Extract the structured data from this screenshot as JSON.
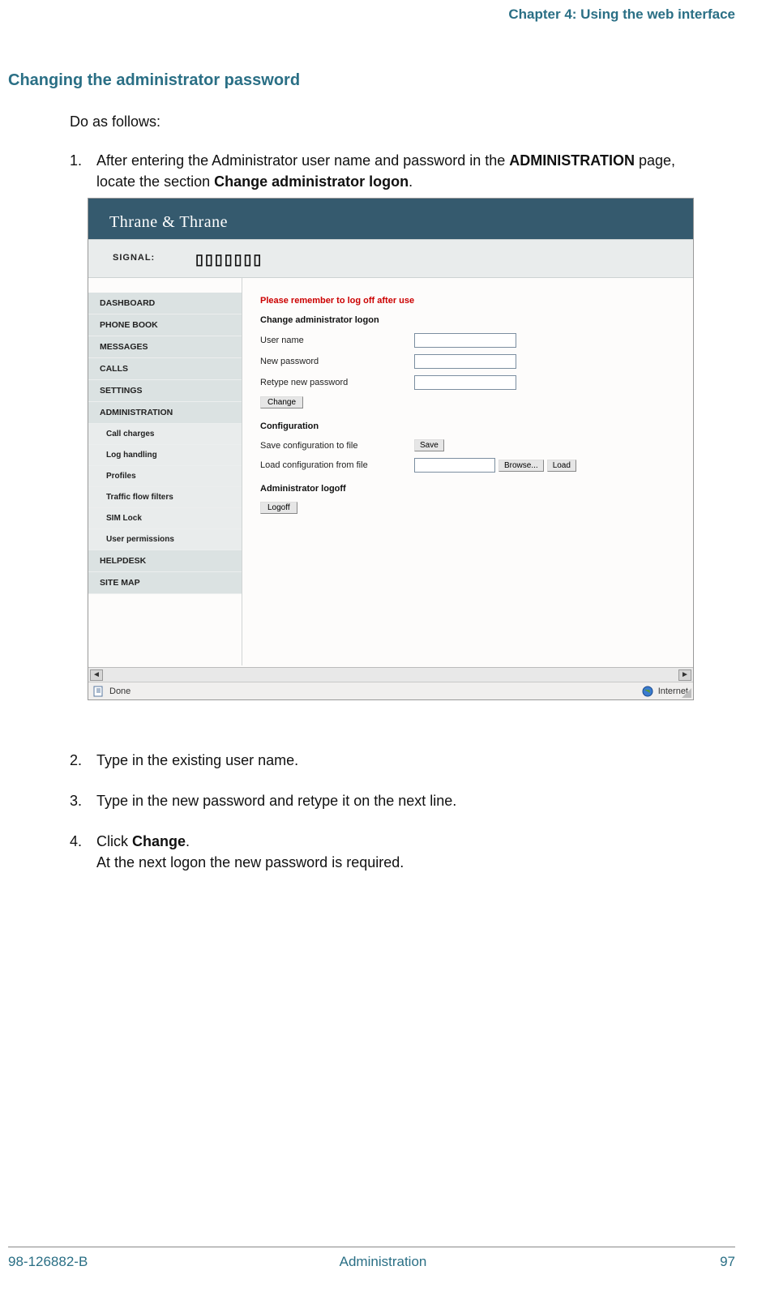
{
  "header": {
    "chapter": "Chapter 4: Using the web interface"
  },
  "section": {
    "title": "Changing the administrator password"
  },
  "intro": "Do as follows:",
  "steps": {
    "s1_num": "1.",
    "s1_a": "After entering the Administrator user name and password in the ",
    "s1_b": "ADMINISTRATION",
    "s1_c": " page, locate the section ",
    "s1_d": "Change administrator logon",
    "s1_e": ".",
    "s2_num": "2.",
    "s2": "Type in the existing user name.",
    "s3_num": "3.",
    "s3": "Type in the new password and retype it on the next line.",
    "s4_num": "4.",
    "s4_a": "Click ",
    "s4_b": "Change",
    "s4_c": ".",
    "s4_d": "At the next logon the new password is required."
  },
  "screenshot": {
    "brand": "Thrane & Thrane",
    "signal_label": "SIGNAL:",
    "signal_bars": "▯▯▯▯▯▯▯",
    "nav": {
      "dashboard": "DASHBOARD",
      "phonebook": "PHONE BOOK",
      "messages": "MESSAGES",
      "calls": "CALLS",
      "settings": "SETTINGS",
      "administration": "ADMINISTRATION",
      "call_charges": "Call charges",
      "log_handling": "Log handling",
      "profiles": "Profiles",
      "traffic_flow": "Traffic flow filters",
      "sim_lock": "SIM Lock",
      "user_permissions": "User permissions",
      "helpdesk": "HELPDESK",
      "sitemap": "SITE MAP"
    },
    "content": {
      "warning": "Please remember to log off after use",
      "group1": "Change administrator logon",
      "username_label": "User name",
      "newpass_label": "New password",
      "retype_label": "Retype new password",
      "change_btn": "Change",
      "group2": "Configuration",
      "save_label": "Save configuration to file",
      "save_btn": "Save",
      "load_label": "Load configuration from file",
      "browse_btn": "Browse...",
      "load_btn": "Load",
      "group3": "Administrator logoff",
      "logoff_btn": "Logoff"
    },
    "status": {
      "done": "Done",
      "zone": "Internet",
      "arrow_left": "◄",
      "arrow_right": "►"
    }
  },
  "footer": {
    "left": "98-126882-B",
    "center": "Administration",
    "right": "97"
  }
}
